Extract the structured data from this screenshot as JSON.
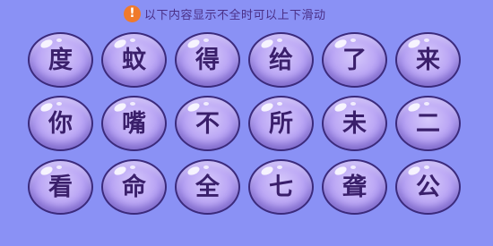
{
  "notice": {
    "icon": "exclamation-icon",
    "text": "以下内容显示不全时可以上下滑动"
  },
  "tiles": [
    "度",
    "蚊",
    "得",
    "给",
    "了",
    "来",
    "你",
    "嘴",
    "不",
    "所",
    "未",
    "二",
    "看",
    "命",
    "全",
    "七",
    "聋",
    "公"
  ],
  "colors": {
    "background": "#8a91f5",
    "tile_fill": "#bda9f5",
    "tile_border": "#3b2a7c",
    "character": "#3a1f6b",
    "notice_icon": "#f07a2c",
    "notice_text": "#4a2f86"
  }
}
